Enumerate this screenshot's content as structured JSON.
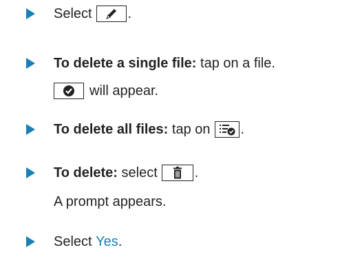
{
  "steps": [
    {
      "text": "Select",
      "suffix": "."
    },
    {
      "bold": "To delete a single file:",
      "text": " tap on a file."
    },
    {
      "continuation": "will appear."
    },
    {
      "bold": "To delete all files:",
      "text": " tap on",
      "suffix": "."
    },
    {
      "bold": "To delete:",
      "text": " select",
      "suffix": "."
    },
    {
      "continuation": "A prompt appears."
    },
    {
      "text": "Select ",
      "link": "Yes",
      "suffix": "."
    }
  ],
  "icons": {
    "edit": "pencil-icon",
    "check": "checkmark-circle-icon",
    "select_all": "select-all-list-check-icon",
    "delete": "trash-icon"
  },
  "colors": {
    "accent": "#1a7fb5",
    "text": "#222222"
  }
}
